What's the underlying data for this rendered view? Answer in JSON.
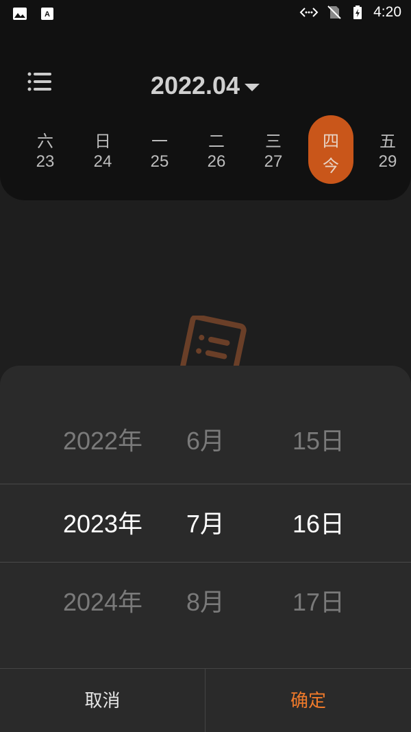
{
  "status_bar": {
    "time": "4:20"
  },
  "header": {
    "month_label": "2022.04",
    "week": [
      {
        "weekday": "六",
        "date": "23"
      },
      {
        "weekday": "日",
        "date": "24"
      },
      {
        "weekday": "一",
        "date": "25"
      },
      {
        "weekday": "二",
        "date": "26"
      },
      {
        "weekday": "三",
        "date": "27"
      },
      {
        "weekday": "四",
        "date": "今"
      },
      {
        "weekday": "五",
        "date": "29"
      }
    ]
  },
  "picker": {
    "rows": [
      {
        "year": "2022年",
        "month": "6月",
        "day": "15日"
      },
      {
        "year": "2023年",
        "month": "7月",
        "day": "16日"
      },
      {
        "year": "2024年",
        "month": "8月",
        "day": "17日"
      }
    ]
  },
  "actions": {
    "cancel_label": "取消",
    "confirm_label": "确定"
  },
  "colors": {
    "accent": "#c9561a",
    "confirm": "#f07a2a",
    "background": "#1e1e1e"
  }
}
